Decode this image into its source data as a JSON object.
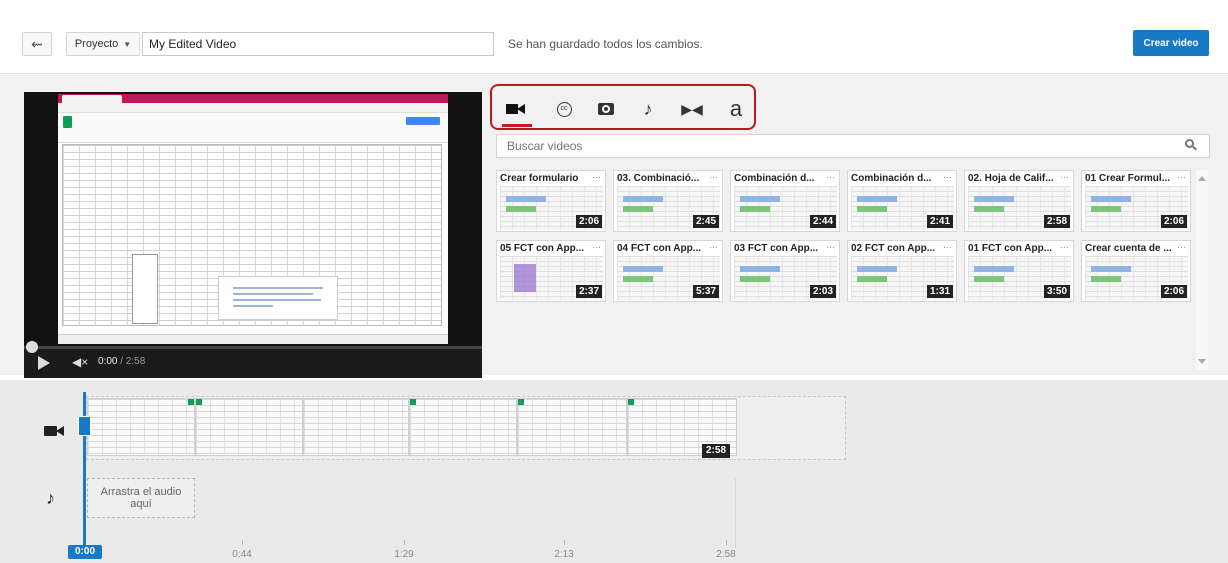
{
  "header": {
    "back_icon": "back-arrow-icon",
    "project_label": "Proyecto",
    "title_value": "My Edited Video",
    "save_status": "Se han guardado todos los cambios.",
    "create_label": "Crear video"
  },
  "player": {
    "current_time": "0:00",
    "duration": "/ 2:58"
  },
  "tabs": [
    {
      "name": "video",
      "icon": "video-camera-icon",
      "glyph": "■◂",
      "active": true
    },
    {
      "name": "cc",
      "icon": "creative-commons-icon",
      "glyph": "cc",
      "active": false
    },
    {
      "name": "photo",
      "icon": "camera-icon",
      "glyph": "📷",
      "active": false
    },
    {
      "name": "audio",
      "icon": "music-note-icon",
      "glyph": "♪",
      "active": false
    },
    {
      "name": "transitions",
      "icon": "transition-icon",
      "glyph": "▸◂",
      "active": false
    },
    {
      "name": "text",
      "icon": "text-icon",
      "glyph": "a",
      "active": false
    }
  ],
  "search": {
    "placeholder": "Buscar videos"
  },
  "clips": [
    {
      "title": "Crear formulario",
      "duration": "2:06"
    },
    {
      "title": "03. Combinació...",
      "duration": "2:45"
    },
    {
      "title": "Combinación d...",
      "duration": "2:44"
    },
    {
      "title": "Combinación d...",
      "duration": "2:41"
    },
    {
      "title": "02. Hoja de Calif...",
      "duration": "2:58"
    },
    {
      "title": "01 Crear Formul...",
      "duration": "2:06"
    },
    {
      "title": "05 FCT con App...",
      "duration": "2:37"
    },
    {
      "title": "04 FCT con App...",
      "duration": "5:37"
    },
    {
      "title": "03 FCT con App...",
      "duration": "2:03"
    },
    {
      "title": "02 FCT con App...",
      "duration": "1:31"
    },
    {
      "title": "01 FCT con App...",
      "duration": "3:50"
    },
    {
      "title": "Crear cuenta de ...",
      "duration": "2:06"
    }
  ],
  "timeline": {
    "clip_duration": "2:58",
    "audio_drop": "Arrastra el audio aquí",
    "playhead_time": "0:00",
    "ruler": [
      "0:44",
      "1:29",
      "2:13",
      "2:58"
    ]
  },
  "colors": {
    "accent": "#167ac6",
    "highlight": "#b71c1c",
    "active_tab": "#cc181e"
  }
}
